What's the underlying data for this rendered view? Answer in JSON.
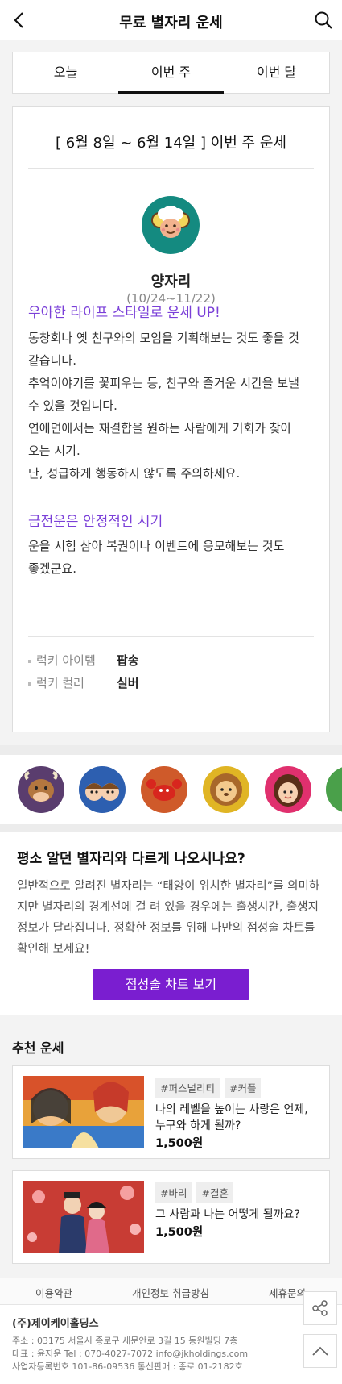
{
  "header": {
    "title": "무료 별자리 운세"
  },
  "tabs": [
    {
      "label": "오늘"
    },
    {
      "label": "이번 주"
    },
    {
      "label": "이번 달"
    }
  ],
  "fortune": {
    "period": "[ 6월 8일 ~ 6월 14일 ] 이번 주 운세",
    "sign_name": "양자리",
    "sign_date": "(10/24~11/22)",
    "headline1": "우아한 라이프 스타일로 운세 UP!",
    "para1_lines": [
      "동창회나 옛 친구와의 모임을 기획해보는 것도 좋을 것",
      "같습니다.",
      "추억이야기를 꽃피우는 등, 친구와 즐거운 시간을 보낼",
      "수 있을 것입니다.",
      "연애면에서는 재결합을 원하는 사람에게 기회가 찾아",
      "오는 시기.",
      "단, 성급하게 행동하지 않도록 주의하세요."
    ],
    "headline2": "금전운은 안정적인 시기",
    "para2_lines": [
      "운을 시험 삼아 복권이나 이벤트에 응모해보는 것도",
      "좋겠군요."
    ],
    "lucky_item_label": "럭키 아이템",
    "lucky_item_value": "팝송",
    "lucky_color_label": "럭키 컬러",
    "lucky_color_value": "실버"
  },
  "info": {
    "title": "평소 알던 별자리와 다르게 나오시나요?",
    "lines": [
      "일반적으로 알려진 별자리는 “태양이 위치한 별자리”를 의미하",
      "지만 별자리의 경계선에 걸 려 있을 경우에는 출생시간, 출생지",
      "정보가 달라집니다. 정확한 정보를 위해 나만의 점성술 차트를",
      "확인해 보세요!"
    ],
    "cta": "점성술 차트 보기"
  },
  "recommend": {
    "title": "추천 운세",
    "items": [
      {
        "tags": [
          "#퍼스널리티",
          "#커플"
        ],
        "desc": "나의 레벨을 높이는 사랑은 언제, 누구와 하게 될까?",
        "price": "1,500원"
      },
      {
        "tags": [
          "#바리",
          "#결혼"
        ],
        "desc": "그 사람과 나는 어떻게 될까요?",
        "price": "1,500원"
      }
    ]
  },
  "footer": {
    "links": [
      "이용약관",
      "개인정보 취급방침",
      "제휴문의"
    ],
    "company": "(주)제이케이홀딩스",
    "address": "주소 : 03175 서울시 종로구 새문안로 3길 15 동원빌딩 7층",
    "contact": "대표 : 윤지운    Tel : 070-4027-7072    info@jkholdings.com",
    "registration": "사업자등록번호 101-86-09536 통신판매 : 종로 01-2182호"
  },
  "colors": {
    "accent_purple": "#7a3fd8",
    "cta_purple": "#7a1ed0"
  }
}
